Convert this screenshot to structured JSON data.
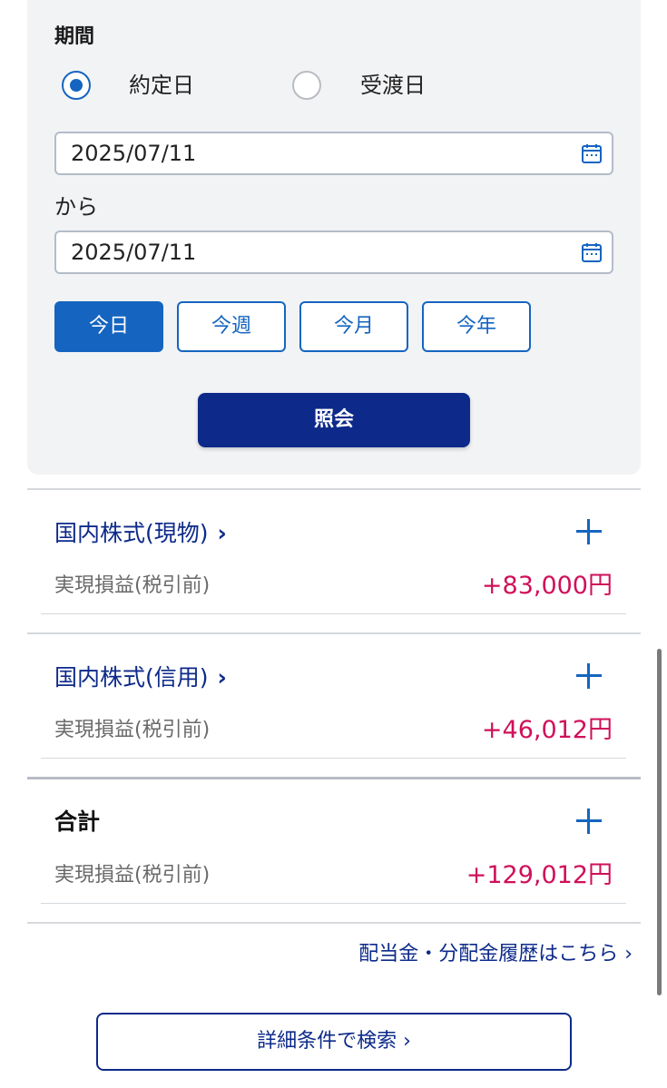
{
  "period": {
    "label": "期間",
    "radio_options": [
      {
        "label": "約定日",
        "checked": true
      },
      {
        "label": "受渡日",
        "checked": false
      }
    ],
    "from_date": "2025/07/11",
    "from_suffix": "から",
    "to_date": "2025/07/11",
    "quick_buttons": [
      {
        "label": "今日",
        "active": true
      },
      {
        "label": "今週",
        "active": false
      },
      {
        "label": "今月",
        "active": false
      },
      {
        "label": "今年",
        "active": false
      }
    ],
    "query_button": "照会"
  },
  "sections": [
    {
      "title": "国内株式(現物)",
      "chevron": "›",
      "row_label": "実現損益(税引前)",
      "value": "+83,000円"
    },
    {
      "title": "国内株式(信用)",
      "chevron": "›",
      "row_label": "実現損益(税引前)",
      "value": "+46,012円"
    },
    {
      "title": "合計",
      "chevron": "",
      "row_label": "実現損益(税引前)",
      "value": "+129,012円"
    }
  ],
  "dividend_link": "配当金・分配金履歴はこちら ›",
  "detail_button": "詳細条件で検索 ›",
  "colors": {
    "accent": "#1565c0",
    "navy": "#0d2a8a",
    "profit": "#d0105a",
    "panel_bg": "#f2f3f5"
  },
  "icons": [
    "calendar-icon",
    "plus-icon",
    "chevron-right-icon"
  ]
}
